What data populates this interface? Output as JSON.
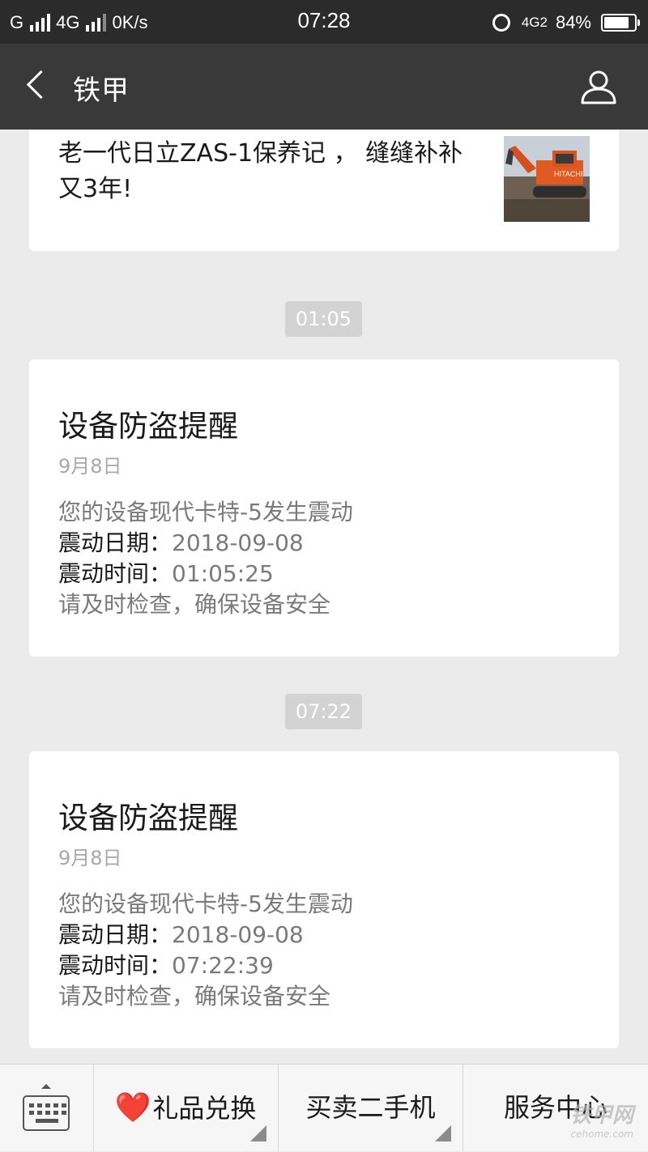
{
  "status_bar": {
    "carrier1": "G",
    "carrier2": "4G",
    "speed": "0K/s",
    "time": "07:28",
    "network_badge": "4G2",
    "battery": "84%",
    "battery_level": 0.84
  },
  "nav": {
    "title": "铁甲",
    "back_icon": "chevron-left-icon",
    "profile_icon": "user-icon"
  },
  "article": {
    "title": "老一代日立ZAS-1保养记 ， 缝缝补补又3年!",
    "thumb_icon": "excavator-image"
  },
  "messages": [
    {
      "time_chip": "01:05",
      "title": "设备防盗提醒",
      "date": "9月8日",
      "line1": "您的设备现代卡特-5发生震动",
      "date_label": "震动日期：",
      "date_value": "2018-09-08",
      "time_label": "震动时间：",
      "time_value": "01:05:25",
      "line4": "请及时检查，确保设备安全"
    },
    {
      "time_chip": "07:22",
      "title": "设备防盗提醒",
      "date": "9月8日",
      "line1": "您的设备现代卡特-5发生震动",
      "date_label": "震动日期：",
      "date_value": "2018-09-08",
      "time_label": "震动时间：",
      "time_value": "07:22:39",
      "line4": "请及时检查，确保设备安全"
    }
  ],
  "bottom_menu": {
    "keyboard_icon": "keyboard-icon",
    "items": [
      {
        "icon": "❤️",
        "label": "礼品兑换"
      },
      {
        "label": "买卖二手机"
      },
      {
        "label": "服务中心"
      }
    ],
    "watermark": "铁甲网",
    "watermark_sub": "cehome.com"
  },
  "colors": {
    "status_bar": "#2b2b2b",
    "nav_bar": "#393939",
    "background": "#ebebeb",
    "card": "#ffffff",
    "chip": "#d3d3d3",
    "heart": "#e0202a"
  }
}
